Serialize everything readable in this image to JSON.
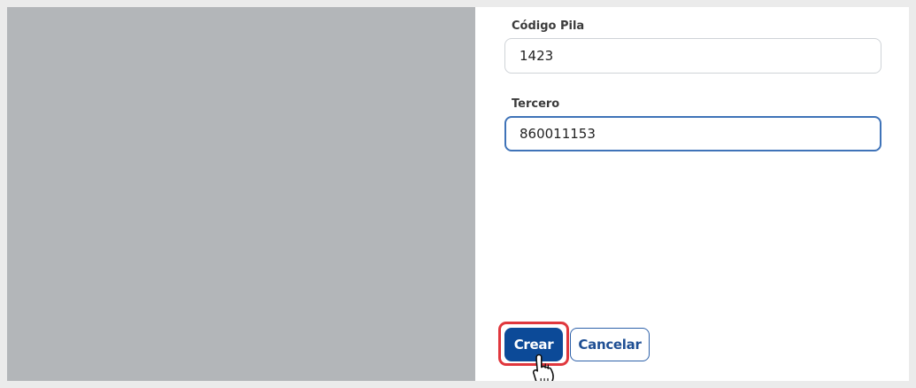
{
  "form": {
    "codigo_pila": {
      "label": "Código Pila",
      "value": "1423"
    },
    "tercero": {
      "label": "Tercero",
      "value": "860011153"
    }
  },
  "actions": {
    "create_label": "Crear",
    "cancel_label": "Cancelar"
  },
  "colors": {
    "primary": "#0c4a98",
    "highlight": "#e0373d",
    "focus_border": "#3f73b8",
    "overlay": "#b3b6b9"
  },
  "icons": {
    "cursor": "hand-pointer-icon"
  }
}
